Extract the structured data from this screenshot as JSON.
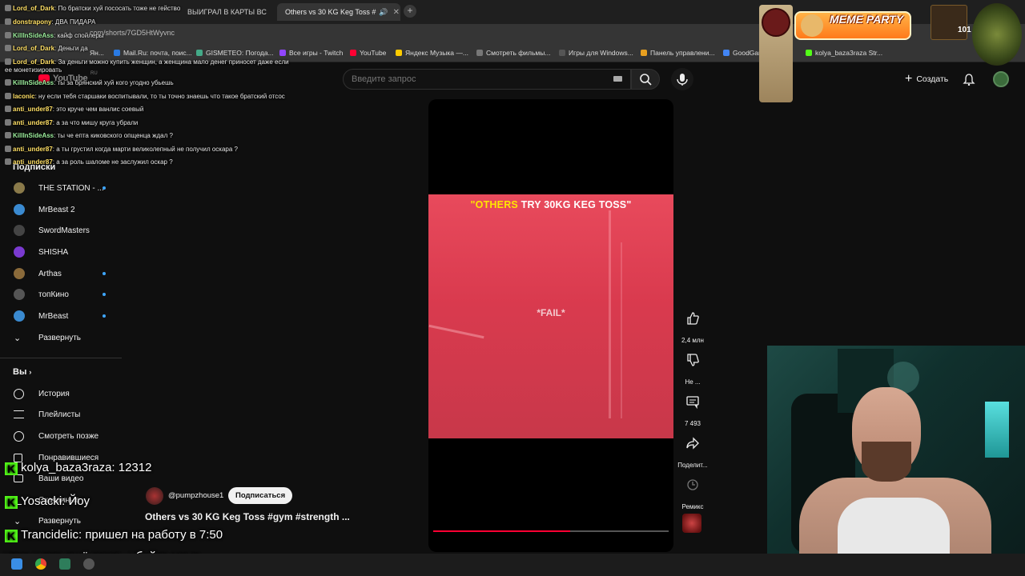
{
  "browser": {
    "tabs": [
      {
        "title": "ВЫИГРАЛ В КАРТЫ ВС",
        "active": false
      },
      {
        "title": "Others vs 30 KG Keg Toss #",
        "active": true
      }
    ],
    "url": "com/shorts/7GD5HtWyvnc",
    "bookmarks": [
      {
        "label": "Ян..."
      },
      {
        "label": "Mail.Ru: почта, поис..."
      },
      {
        "label": "GISMETEO: Погода..."
      },
      {
        "label": "Все игры - Twitch"
      },
      {
        "label": "YouTube"
      },
      {
        "label": "Яндекс Музыка —..."
      },
      {
        "label": "Смотреть фильмы..."
      },
      {
        "label": "Игры для Windows..."
      },
      {
        "label": "Панель управлени..."
      },
      {
        "label": "GoodGam"
      },
      {
        "label": "kolya_baza3raza Str..."
      }
    ]
  },
  "header": {
    "search_placeholder": "Введите запрос",
    "create_label": "Создать",
    "logo_text": "YouTube",
    "logo_region": "RU"
  },
  "sidebar": {
    "subscriptions_title": "Подписки",
    "subscriptions": [
      {
        "label": "THE STATION - ...",
        "dot": true,
        "color": "#8a7a4a"
      },
      {
        "label": "MrBeast 2",
        "dot": false,
        "color": "#3a8ad0"
      },
      {
        "label": "SwordMasters",
        "dot": false,
        "color": "#444444"
      },
      {
        "label": "SHISHA",
        "dot": false,
        "color": "#7a3ad0"
      },
      {
        "label": "Arthas",
        "dot": true,
        "color": "#8a6a3a"
      },
      {
        "label": "топКино",
        "dot": true,
        "color": "#555555"
      },
      {
        "label": "MrBeast",
        "dot": true,
        "color": "#3a8ad0"
      }
    ],
    "expand_label": "Развернуть",
    "you_title": "Вы",
    "you_items": [
      {
        "label": "История"
      },
      {
        "label": "Плейлисты"
      },
      {
        "label": "Смотреть позже"
      },
      {
        "label": "Понравившиеся"
      },
      {
        "label": "Ваши видео"
      },
      {
        "label": "Скачанные"
      }
    ],
    "expand_label_2": "Развернуть"
  },
  "chat_overlay": [
    {
      "nick": "Lord_of_Dark",
      "text": "По братски хуй пососать тоже не гейство"
    },
    {
      "nick": "donstrapony",
      "text": "ДВА ПИДАРА"
    },
    {
      "nick": "KillInSideAss",
      "text": "кайф спойлеры"
    },
    {
      "nick": "Lord_of_Dark",
      "text": "Деньги да"
    },
    {
      "nick": "Lord_of_Dark",
      "text": "За деньги можно купить женщин, а женщина мало денег приносет даже если"
    },
    {
      "nick": "",
      "text": "ее монетизировать"
    },
    {
      "nick": "KillInSideAss",
      "text": "ты за брянский хуй кого угодно убьешь"
    },
    {
      "nick": "laconic",
      "text": "ну если тебя старшаки воспитывали, то ты точно знаешь что такое братский отсос"
    },
    {
      "nick": "anti_under87",
      "text": "это круче чем ванлис соевый"
    },
    {
      "nick": "anti_under87",
      "text": "а за что мишу круга убрали"
    },
    {
      "nick": "KillInSideAss",
      "text": "ты че епта киковского опщенца ждал ?"
    },
    {
      "nick": "anti_under87",
      "text": "а ты грустил когда марти великолепный не получил оскара ?"
    },
    {
      "nick": "anti_under87",
      "text": "а за роль шаломе не заслужил оскар ?"
    }
  ],
  "kick_chat": [
    {
      "nick": "kolya_baza3raza:",
      "text": "12312"
    },
    {
      "nick": "Yosacki:",
      "text": "Йоу"
    },
    {
      "nick": "Trancidelic:",
      "text": "пришел на работу в 7:50"
    },
    {
      "nick": "",
      "text": "утра и все ещё здесь. убейте меня"
    }
  ],
  "video": {
    "overlay_highlight": "\"OTHERS",
    "overlay_rest": " TRY 30KG KEG TOSS\"",
    "overlay_fail": "*FAIL*",
    "progress": 0.58,
    "channel": "@pumpzhouse1",
    "subscribe_label": "Подписаться",
    "title": "Others vs 30 KG Keg Toss #gym #strength ..."
  },
  "actions": {
    "like_count": "2,4 млн",
    "dislike_label": "Не ...",
    "comments_count": "7 493",
    "share_label": "Поделит...",
    "remix_label": "Ремикс"
  },
  "stream_overlay": {
    "meme_party_text": "MEME PARTY",
    "counter": "101"
  },
  "colors": {
    "accent_red": "#ff0033",
    "link_blue": "#3ea6ff",
    "kick_green": "#53fc18"
  }
}
